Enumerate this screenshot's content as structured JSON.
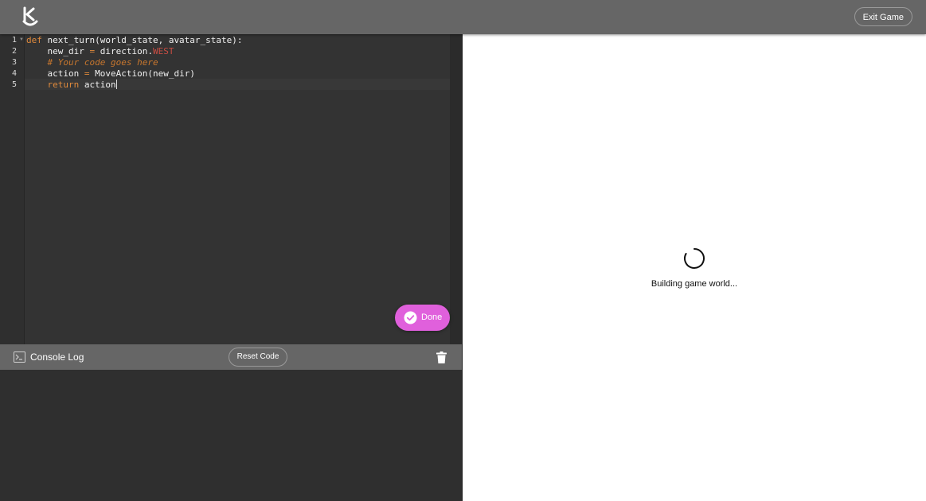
{
  "header": {
    "logo_icon": "kurono-logo-icon",
    "exit_label": "Exit Game"
  },
  "editor": {
    "line_numbers": [
      "1",
      "2",
      "3",
      "4",
      "5"
    ],
    "lines": [
      [
        {
          "t": "def",
          "c": "kw"
        },
        {
          "t": " next_turn(world_state, avatar_state):",
          "c": ""
        }
      ],
      [
        {
          "t": "    new_dir ",
          "c": ""
        },
        {
          "t": "=",
          "c": "op"
        },
        {
          "t": " direction.",
          "c": ""
        },
        {
          "t": "WEST",
          "c": "const"
        }
      ],
      [
        {
          "t": "    # Your code goes here",
          "c": "comment"
        }
      ],
      [
        {
          "t": "    action ",
          "c": ""
        },
        {
          "t": "=",
          "c": "op"
        },
        {
          "t": " MoveAction(new_dir)",
          "c": ""
        }
      ],
      [
        {
          "t": "    ",
          "c": ""
        },
        {
          "t": "return",
          "c": "kw"
        },
        {
          "t": " action",
          "c": ""
        }
      ]
    ],
    "done_label": "Done"
  },
  "console": {
    "title": "Console Log",
    "reset_label": "Reset Code",
    "clear_icon": "trash-icon"
  },
  "game": {
    "status_text": "Building game world..."
  },
  "colors": {
    "header_bg": "#666666",
    "editor_bg": "#333333",
    "done_button": "#e060dc",
    "keyword": "#e08a3c",
    "constant": "#c94d43"
  }
}
